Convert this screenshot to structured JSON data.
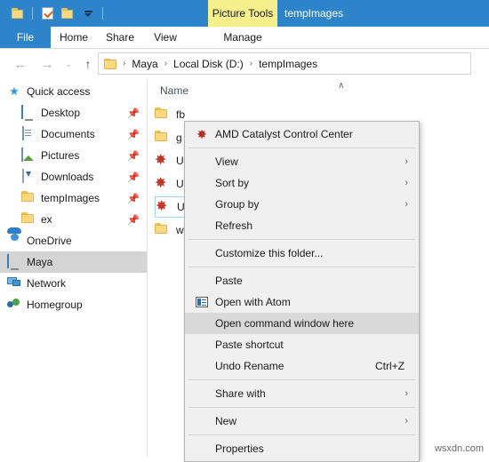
{
  "window": {
    "title": "tempImages",
    "contextual_tab": "Picture Tools",
    "titlebar_color": "#2e84c8",
    "contextual_tab_color": "#f5f08c"
  },
  "quick_access_toolbar": {
    "items": [
      {
        "icon": "folder-icon",
        "name": "explorer-icon"
      },
      {
        "icon": "properties-icon",
        "name": "properties-quick-button"
      },
      {
        "icon": "new-folder-icon",
        "name": "new-folder-quick-button"
      },
      {
        "icon": "chevron-down-icon",
        "name": "customize-qat-button"
      }
    ]
  },
  "ribbon": {
    "tabs": [
      {
        "label": "File",
        "active": true
      },
      {
        "label": "Home",
        "active": false
      },
      {
        "label": "Share",
        "active": false
      },
      {
        "label": "View",
        "active": false
      },
      {
        "label": "Manage",
        "active": false
      }
    ]
  },
  "address_bar": {
    "back_icon": "←",
    "forward_icon": "→",
    "history_icon": "⌄",
    "up_icon": "↑",
    "crumbs": [
      "Maya",
      "Local Disk (D:)",
      "tempImages"
    ],
    "separator": "›"
  },
  "sidebar": {
    "items": [
      {
        "label": "Quick access",
        "icon": "star-icon",
        "pinned": false,
        "selected": false,
        "indent": 0
      },
      {
        "label": "Desktop",
        "icon": "monitor-icon",
        "pinned": true,
        "selected": false,
        "indent": 1
      },
      {
        "label": "Documents",
        "icon": "document-icon",
        "pinned": true,
        "selected": false,
        "indent": 1
      },
      {
        "label": "Pictures",
        "icon": "pictures-icon",
        "pinned": true,
        "selected": false,
        "indent": 1
      },
      {
        "label": "Downloads",
        "icon": "download-icon",
        "pinned": true,
        "selected": false,
        "indent": 1
      },
      {
        "label": "tempImages",
        "icon": "folder-icon",
        "pinned": true,
        "selected": false,
        "indent": 1
      },
      {
        "label": "ex",
        "icon": "folder-icon",
        "pinned": true,
        "selected": false,
        "indent": 1
      },
      {
        "label": "OneDrive",
        "icon": "cloud-icon",
        "pinned": false,
        "selected": false,
        "indent": 0
      },
      {
        "label": "Maya",
        "icon": "monitor-icon",
        "pinned": false,
        "selected": true,
        "indent": 0
      },
      {
        "label": "Network",
        "icon": "network-icon",
        "pinned": false,
        "selected": false,
        "indent": 0
      },
      {
        "label": "Homegroup",
        "icon": "homegroup-icon",
        "pinned": false,
        "selected": false,
        "indent": 0
      }
    ],
    "pin_glyph": "📌"
  },
  "file_list": {
    "column_header": "Name",
    "sort_chevron": "∧",
    "rows": [
      {
        "name": "fb",
        "icon": "folder-icon",
        "selected": false
      },
      {
        "name": "g",
        "icon": "folder-icon",
        "selected": false
      },
      {
        "name": "U",
        "icon": "maya-file-icon",
        "selected": false
      },
      {
        "name": "U",
        "icon": "maya-file-icon",
        "selected": false
      },
      {
        "name": "U",
        "icon": "maya-file-icon",
        "selected": true
      },
      {
        "name": "w",
        "icon": "folder-icon",
        "selected": false
      }
    ]
  },
  "context_menu": {
    "highlight_color": "#d9d9d9",
    "items": [
      {
        "type": "item",
        "label": "AMD Catalyst Control Center",
        "icon": "amd-icon",
        "submenu": false,
        "accel": "",
        "hover": false
      },
      {
        "type": "separator"
      },
      {
        "type": "item",
        "label": "View",
        "icon": "",
        "submenu": true,
        "accel": "",
        "hover": false
      },
      {
        "type": "item",
        "label": "Sort by",
        "icon": "",
        "submenu": true,
        "accel": "",
        "hover": false
      },
      {
        "type": "item",
        "label": "Group by",
        "icon": "",
        "submenu": true,
        "accel": "",
        "hover": false
      },
      {
        "type": "item",
        "label": "Refresh",
        "icon": "",
        "submenu": false,
        "accel": "",
        "hover": false
      },
      {
        "type": "separator"
      },
      {
        "type": "item",
        "label": "Customize this folder...",
        "icon": "",
        "submenu": false,
        "accel": "",
        "hover": false
      },
      {
        "type": "separator"
      },
      {
        "type": "item",
        "label": "Paste",
        "icon": "",
        "submenu": false,
        "accel": "",
        "hover": false
      },
      {
        "type": "item",
        "label": "Open with Atom",
        "icon": "atom-icon",
        "submenu": false,
        "accel": "",
        "hover": false
      },
      {
        "type": "item",
        "label": "Open command window here",
        "icon": "",
        "submenu": false,
        "accel": "",
        "hover": true
      },
      {
        "type": "item",
        "label": "Paste shortcut",
        "icon": "",
        "submenu": false,
        "accel": "",
        "hover": false
      },
      {
        "type": "item",
        "label": "Undo Rename",
        "icon": "",
        "submenu": false,
        "accel": "Ctrl+Z",
        "hover": false
      },
      {
        "type": "separator"
      },
      {
        "type": "item",
        "label": "Share with",
        "icon": "",
        "submenu": true,
        "accel": "",
        "hover": false
      },
      {
        "type": "separator"
      },
      {
        "type": "item",
        "label": "New",
        "icon": "",
        "submenu": true,
        "accel": "",
        "hover": false
      },
      {
        "type": "separator"
      },
      {
        "type": "item",
        "label": "Properties",
        "icon": "",
        "submenu": false,
        "accel": "",
        "hover": false
      }
    ],
    "submenu_arrow": "›"
  },
  "watermark": "wsxdn.com"
}
